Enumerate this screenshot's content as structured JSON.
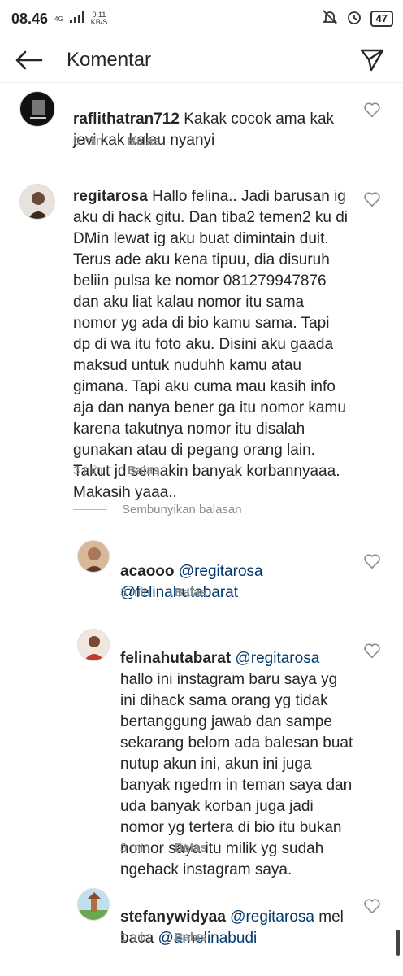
{
  "status_bar": {
    "time": "08.46",
    "network": "4G",
    "speed_value": "0.11",
    "speed_unit": "KB/S",
    "battery": "47"
  },
  "app_bar": {
    "title": "Komentar",
    "back_icon": "arrow-left-icon",
    "send_icon": "direct-send-icon"
  },
  "comments": [
    {
      "username": "raflithatran712",
      "text": " Kakak cocok ama kak jevi kak kalau nyanyi",
      "time": "6 min",
      "reply_label": "Balas"
    },
    {
      "username": "regitarosa",
      "text": " Hallo felina.. Jadi barusan ig aku di hack gitu. Dan tiba2 temen2 ku di DMin lewat ig aku buat dimintain duit. Terus ade aku kena tipuu, dia disuruh beliin pulsa ke nomor 081279947876 dan aku liat kalau nomor itu sama nomor yg ada di bio kamu sama. Tapi dp di wa itu foto aku. Disini aku gaada maksud untuk nuduhh kamu atau gimana. Tapi aku cuma mau kasih info aja dan nanya bener ga itu nomor kamu karena takutnya nomor itu disalah gunakan atau di pegang orang lain. Takut jd semakin banyak korbannyaaa. Makasih yaaa..",
      "time": "3 min",
      "reply_label": "Balas"
    }
  ],
  "hide_replies_label": "Sembunyikan balasan",
  "replies": [
    {
      "username": "acaooo",
      "mention1": " @regitarosa",
      "mention2": "@felinahutabarat",
      "time": "3 min",
      "reply_label": "Balas"
    },
    {
      "username": "felinahutabarat",
      "mention1": " @regitarosa",
      "text": "hallo ini instagram baru saya yg ini dihack sama orang yg tidak bertanggung jawab dan sampe sekarang belom ada balesan buat nutup akun ini, akun ini juga banyak ngedm in teman saya dan uda banyak korban juga jadi nomor yg tertera di bio itu bukan nomor saya itu milik yg sudah ngehack instagram saya.",
      "time": "3 min",
      "reply_label": "Balas"
    },
    {
      "username": "stefanywidyaa",
      "mention1": " @regitarosa",
      "text_mid": " mel baca ",
      "mention2": "@amelinabudi",
      "time": "1 min",
      "reply_label": "Balas"
    }
  ]
}
